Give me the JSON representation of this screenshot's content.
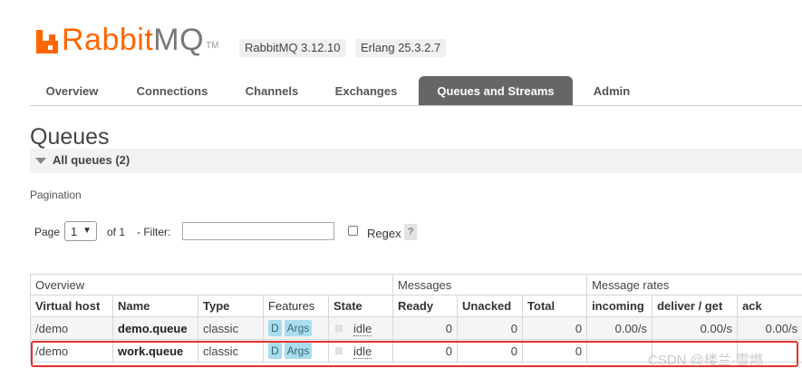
{
  "header": {
    "logo_rabbit": "Rabbit",
    "logo_mq": "MQ",
    "logo_tm": "TM",
    "rabbitmq_version": "RabbitMQ 3.12.10",
    "erlang_version": "Erlang 25.3.2.7"
  },
  "nav": {
    "tabs": [
      "Overview",
      "Connections",
      "Channels",
      "Exchanges",
      "Queues and Streams",
      "Admin"
    ],
    "active": "Queues and Streams"
  },
  "page": {
    "title": "Queues",
    "section_label": "All queues (2)"
  },
  "pagination": {
    "label": "Pagination",
    "page_label": "Page",
    "page_value": "1",
    "of_label": "of 1",
    "filter_label": "- Filter:",
    "filter_value": "",
    "regex_label": "Regex",
    "help_label": "?"
  },
  "table": {
    "groups": [
      "Overview",
      "Messages",
      "Message rates"
    ],
    "columns": [
      "Virtual host",
      "Name",
      "Type",
      "Features",
      "State",
      "Ready",
      "Unacked",
      "Total",
      "incoming",
      "deliver / get",
      "ack"
    ],
    "rows": [
      {
        "vhost": "/demo",
        "name": "demo.queue",
        "type": "classic",
        "feature_d": "D",
        "feature_args": "Args",
        "state": "idle",
        "ready": "0",
        "unacked": "0",
        "total": "0",
        "incoming": "0.00/s",
        "deliver_get": "0.00/s",
        "ack": "0.00/s"
      },
      {
        "vhost": "/demo",
        "name": "work.queue",
        "type": "classic",
        "feature_d": "D",
        "feature_args": "Args",
        "state": "idle",
        "ready": "0",
        "unacked": "0",
        "total": "0",
        "incoming": "",
        "deliver_get": "",
        "ack": ""
      }
    ]
  },
  "watermark": "CSDN @楼兰·雪燃",
  "colors": {
    "brand": "#ff6600",
    "active_tab": "#666666",
    "feature_badge": "#aaddee",
    "highlight": "#e83030"
  }
}
